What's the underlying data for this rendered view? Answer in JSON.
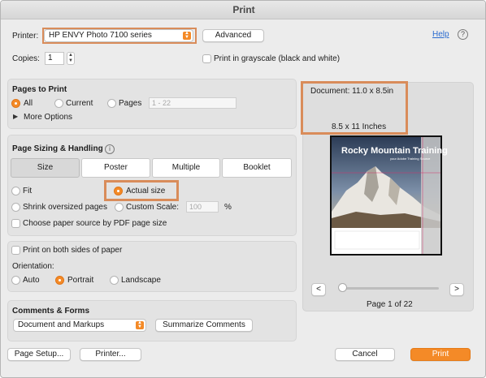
{
  "window": {
    "title": "Print"
  },
  "printer": {
    "label": "Printer:",
    "value": "HP ENVY Photo 7100 series",
    "advanced_label": "Advanced",
    "help_label": "Help",
    "help_icon": "question-circle-icon"
  },
  "copies": {
    "label": "Copies:",
    "value": "1",
    "grayscale_label": "Print in grayscale (black and white)"
  },
  "pages": {
    "title": "Pages to Print",
    "options": [
      "All",
      "Current",
      "Pages"
    ],
    "selected": "All",
    "range_placeholder": "1 - 22",
    "more_options_label": "More Options"
  },
  "sizing": {
    "title": "Page Sizing & Handling",
    "tabs": [
      "Size",
      "Poster",
      "Multiple",
      "Booklet"
    ],
    "selected_tab": "Size",
    "fit_label": "Fit",
    "actual_size_label": "Actual size",
    "shrink_label": "Shrink oversized pages",
    "custom_scale_label": "Custom Scale:",
    "custom_scale_value": "100",
    "percent": "%",
    "choose_source_label": "Choose paper source by PDF page size"
  },
  "duplex": {
    "label": "Print on both sides of paper"
  },
  "orientation": {
    "label": "Orientation:",
    "options": [
      "Auto",
      "Portrait",
      "Landscape"
    ],
    "selected": "Portrait"
  },
  "comments": {
    "title": "Comments & Forms",
    "value": "Document and Markups",
    "summarize_label": "Summarize Comments"
  },
  "preview": {
    "document_size": "Document: 11.0 x 8.5in",
    "paper_size": "8.5 x 11 Inches",
    "thumb_title": "Rocky Mountain Training",
    "thumb_subtitle": "your Adobe Training Source",
    "page_indicator": "Page 1 of 22",
    "prev_label": "<",
    "next_label": ">"
  },
  "footer": {
    "page_setup_label": "Page Setup...",
    "printer_label": "Printer...",
    "cancel_label": "Cancel",
    "print_label": "Print"
  },
  "colors": {
    "accent": "#f48a27",
    "highlight": "#d98c5a",
    "link": "#2a6bcf"
  }
}
